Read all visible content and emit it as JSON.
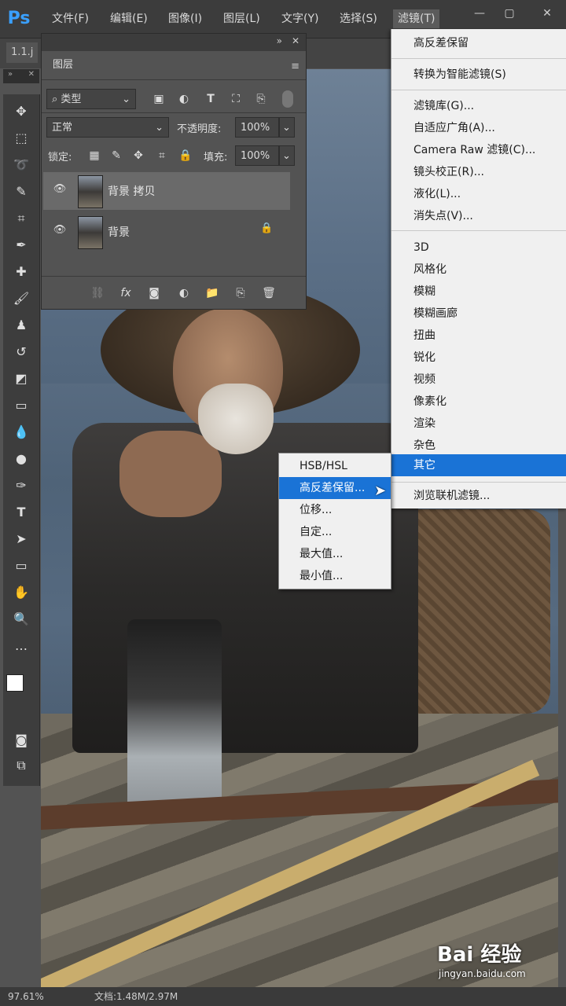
{
  "app": {
    "logo": "Ps"
  },
  "menubar": {
    "items": [
      "文件(F)",
      "编辑(E)",
      "图像(I)",
      "图层(L)",
      "文字(Y)",
      "选择(S)",
      "滤镜(T)"
    ],
    "window_controls": [
      "—",
      "▢",
      "✕"
    ]
  },
  "document": {
    "tab": "1.1.j"
  },
  "layers_panel": {
    "title": "图层",
    "filter_kind": "类型",
    "blend_mode": "正常",
    "opacity_label": "不透明度:",
    "opacity_value": "100%",
    "lock_label": "锁定:",
    "fill_label": "填充:",
    "fill_value": "100%",
    "layers": [
      {
        "name": "背景 拷贝",
        "selected": true
      },
      {
        "name": "背景",
        "locked": true
      }
    ]
  },
  "filter_menu": {
    "groups": [
      [
        "高反差保留"
      ],
      [
        "转换为智能滤镜(S)"
      ],
      [
        "滤镜库(G)...",
        "自适应广角(A)...",
        "Camera Raw 滤镜(C)...",
        "镜头校正(R)...",
        "液化(L)...",
        "消失点(V)..."
      ],
      [
        "3D",
        "风格化",
        "模糊",
        "模糊画廊",
        "扭曲",
        "锐化",
        "视频",
        "像素化",
        "渲染",
        "杂色",
        "其它"
      ],
      [
        "浏览联机滤镜..."
      ]
    ],
    "highlighted": "其它"
  },
  "other_submenu": {
    "items": [
      "HSB/HSL",
      "高反差保留...",
      "位移...",
      "自定...",
      "最大值...",
      "最小值..."
    ],
    "highlighted": "高反差保留..."
  },
  "status": {
    "zoom": "97.61%",
    "doc_info": "文档:1.48M/2.97M"
  },
  "watermark": {
    "brand": "Bai 经验",
    "url": "jingyan.baidu.com"
  },
  "colors": {
    "highlight": "#1a73d6",
    "menu_bg": "#f0f0f0",
    "ui_dark": "#3c3c3c"
  }
}
